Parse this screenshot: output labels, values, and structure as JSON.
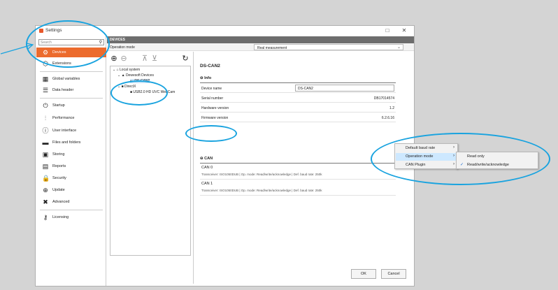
{
  "window": {
    "title": "Settings",
    "minimize": "□",
    "close": "✕"
  },
  "sidebar": {
    "search_placeholder": "Search",
    "items": [
      {
        "label": "Devices",
        "icon": "gear-icon",
        "glyph": "⚙",
        "active": true
      },
      {
        "label": "Extensions",
        "icon": "cube-icon",
        "glyph": "⬡"
      },
      {
        "label": "Global variables",
        "icon": "calendar-icon",
        "glyph": "▦"
      },
      {
        "label": "Data header",
        "icon": "list-icon",
        "glyph": "☰"
      },
      {
        "label": "Startup",
        "icon": "power-icon",
        "glyph": "⏻"
      },
      {
        "label": "Performance",
        "icon": "sliders-icon",
        "glyph": "⫶"
      },
      {
        "label": "User interface",
        "icon": "info-icon",
        "glyph": "ⓘ"
      },
      {
        "label": "Files and folders",
        "icon": "folder-icon",
        "glyph": "▬"
      },
      {
        "label": "Storing",
        "icon": "save-icon",
        "glyph": "▣"
      },
      {
        "label": "Reports",
        "icon": "report-icon",
        "glyph": "▤"
      },
      {
        "label": "Security",
        "icon": "lock-icon",
        "glyph": "🔒"
      },
      {
        "label": "Update",
        "icon": "update-icon",
        "glyph": "⊕"
      },
      {
        "label": "Advanced",
        "icon": "tools-icon",
        "glyph": "✖"
      },
      {
        "label": "Licensing",
        "icon": "key-icon",
        "glyph": "⚷"
      }
    ]
  },
  "devices_header": "DEVICES",
  "operation_mode": {
    "label": "Operation mode",
    "value": "Real measurement"
  },
  "tree": {
    "root": "Local system",
    "group1": "Dewesoft Devices",
    "item1": "DS-CAN2",
    "group2": "DirectX",
    "item2": "USB2.0 HD UVC WebCam"
  },
  "details": {
    "title": "DS-CAN2",
    "info_section": "Info",
    "rows": [
      {
        "key": "Device name",
        "value": "DS-CAN2"
      },
      {
        "key": "Serial number",
        "value": "DB17014574"
      },
      {
        "key": "Hardware version",
        "value": "1.2"
      },
      {
        "key": "Firmware version",
        "value": "6.2.6.16"
      }
    ],
    "can_section": "CAN",
    "can": [
      {
        "title": "CAN 0",
        "desc": "Transceiver: ISO1050DUB | Op. mode: Read/write/acknowledge | Def. baud rate: 250k"
      },
      {
        "title": "CAN 1",
        "desc": "Transceiver: ISO1050DUB | Op. mode: Read/write/acknowledge | Def. baud rate: 250k"
      }
    ]
  },
  "buttons": {
    "ok": "OK",
    "cancel": "Cancel"
  },
  "context_menu": {
    "items": [
      "Default baud rate",
      "Operation mode",
      "CAN Plugin"
    ],
    "submenu": [
      "Read only",
      "Read/write/acknowledge"
    ],
    "checked": "Read/write/acknowledge"
  },
  "colors": {
    "accent": "#ec6b2d",
    "highlight_ellipse": "#19a3df"
  }
}
